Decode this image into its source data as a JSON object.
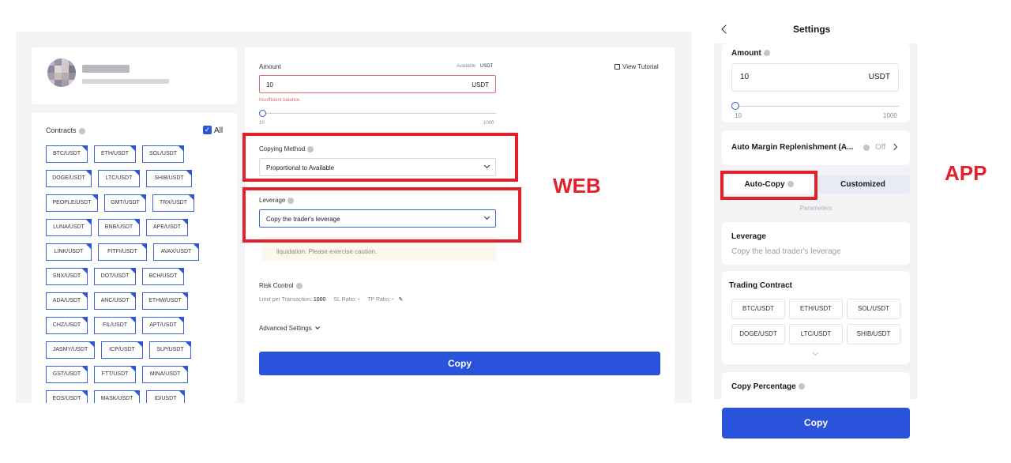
{
  "web": {
    "contracts": {
      "title": "Contracts",
      "all_label": "All",
      "all_checked": true,
      "pairs": [
        "BTC/USDT",
        "ETH/USDT",
        "SOL/USDT",
        "DOGE/USDT",
        "LTC/USDT",
        "SHIB/USDT",
        "PEOPLE/USDT",
        "GMT/USDT",
        "TRX/USDT",
        "LUNA/USDT",
        "BNB/USDT",
        "APE/USDT",
        "LINK/USDT",
        "FITFI/USDT",
        "AVAX/USDT",
        "SNX/USDT",
        "DOT/USDT",
        "BCH/USDT",
        "ADA/USDT",
        "ANC/USDT",
        "ETHW/USDT",
        "CHZ/USDT",
        "FIL/USDT",
        "APT/USDT",
        "JASMY/USDT",
        "ICP/USDT",
        "SLP/USDT",
        "GST/USDT",
        "FTT/USDT",
        "MINA/USDT",
        "EOS/USDT",
        "MASK/USDT",
        "ID/USDT"
      ]
    },
    "amount": {
      "label": "Amount",
      "available_label": "Available",
      "available_unit": "USDT",
      "view_tutorial": "View Tutorial",
      "value": "10",
      "unit": "USDT",
      "error": "Insufficient balance.",
      "slider_min": "10",
      "slider_max": "1000"
    },
    "copying_method": {
      "label": "Copying Method",
      "value": "Proportional to Available"
    },
    "leverage": {
      "label": "Leverage",
      "value": "Copy the trader's leverage",
      "warning": "liquidation. Please exercise caution."
    },
    "risk_control": {
      "label": "Risk Control",
      "limit_label": "Limit per Transaction:",
      "limit_value": "1000",
      "sl_label": "SL Ratio:",
      "sl_value": "-",
      "tp_label": "TP Ratio:",
      "tp_value": "-"
    },
    "advanced_settings": "Advanced Settings",
    "copy_button": "Copy",
    "tag": "WEB"
  },
  "app": {
    "title": "Settings",
    "amount": {
      "label": "Amount",
      "value": "10",
      "unit": "USDT",
      "slider_min": "10",
      "slider_max": "1000"
    },
    "auto_margin": {
      "label": "Auto Margin Replenishment (A...",
      "value": "Off"
    },
    "tabs": {
      "auto_copy": "Auto-Copy",
      "customized": "Customized"
    },
    "parameters_label": "Parameters",
    "leverage": {
      "label": "Leverage",
      "value": "Copy the lead trader's leverage"
    },
    "trading_contract": {
      "label": "Trading Contract",
      "pairs": [
        "BTC/USDT",
        "ETH/USDT",
        "SOL/USDT",
        "DOGE/USDT",
        "LTC/USDT",
        "SHIB/USDT"
      ]
    },
    "copy_percentage_label": "Copy Percentage",
    "copy_button": "Copy",
    "tag": "APP"
  },
  "colors": {
    "accent": "#2a53dc",
    "highlight_red": "#e4202d",
    "error_red": "#e06b6b"
  }
}
